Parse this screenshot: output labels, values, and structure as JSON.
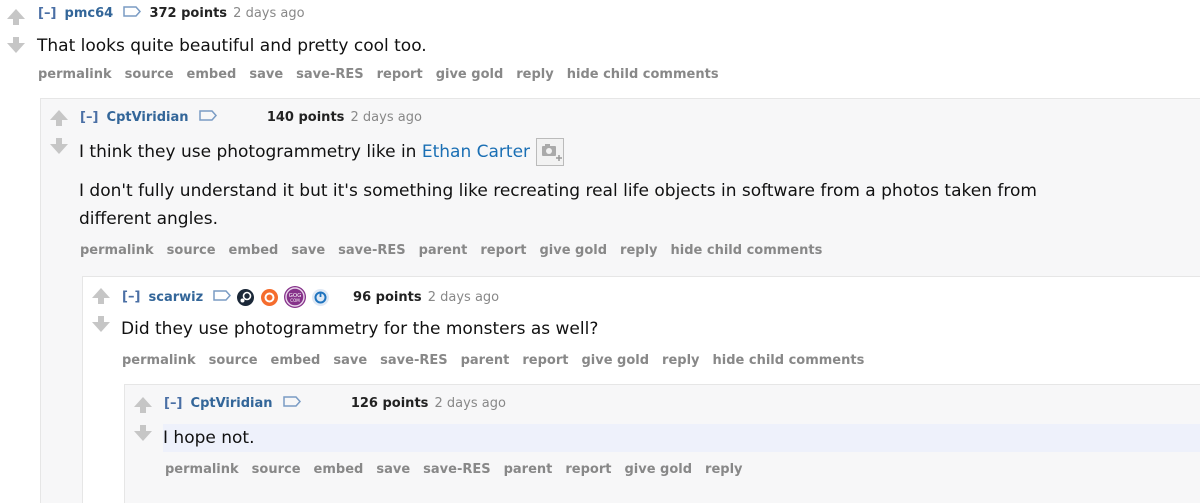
{
  "comments": [
    {
      "collapse": "[–]",
      "author": "pmc64",
      "score": "372 points",
      "time": "2 days ago",
      "text": "That looks quite beautiful and pretty cool too.",
      "buttons": [
        "permalink",
        "source",
        "embed",
        "save",
        "save-RES",
        "report",
        "give gold",
        "reply",
        "hide child comments"
      ]
    },
    {
      "collapse": "[–]",
      "author": "CptViridian",
      "score": "140 points",
      "time": "2 days ago",
      "text_before_link": "I think they use photogrammetry like in ",
      "link": "Ethan Carter",
      "text2_line1": "I don't fully understand it but it's something like recreating real life objects in software from a photos taken from",
      "text2_line2": "different angles.",
      "buttons": [
        "permalink",
        "source",
        "embed",
        "save",
        "save-RES",
        "parent",
        "report",
        "give gold",
        "reply",
        "hide child comments"
      ]
    },
    {
      "collapse": "[–]",
      "author": "scarwiz",
      "score": "96 points",
      "time": "2 days ago",
      "text": "Did they use photogrammetry for the monsters as well?",
      "buttons": [
        "permalink",
        "source",
        "embed",
        "save",
        "save-RES",
        "parent",
        "report",
        "give gold",
        "reply",
        "hide child comments"
      ]
    },
    {
      "collapse": "[–]",
      "author": "CptViridian",
      "score": "126 points",
      "time": "2 days ago",
      "text": "I hope not.",
      "buttons": [
        "permalink",
        "source",
        "embed",
        "save",
        "save-RES",
        "parent",
        "report",
        "give gold",
        "reply"
      ]
    }
  ],
  "icons": {
    "tag": "tag-icon",
    "flairs": [
      "steam-icon",
      "origin-icon",
      "gog-icon",
      "uplay-icon"
    ],
    "expando": "image-expando-icon"
  },
  "colors": {
    "author": "#336699",
    "link": "#1a6fb4",
    "buttons": "#888888",
    "nested_odd_bg": "#f7f7f8"
  }
}
